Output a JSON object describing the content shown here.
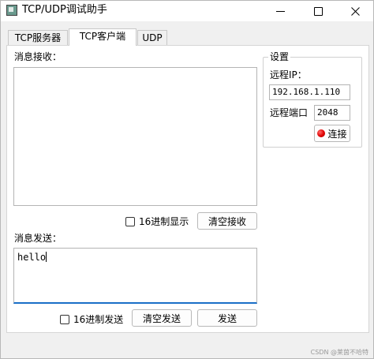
{
  "window": {
    "title": "TCP/UDP调试助手"
  },
  "tabs": [
    {
      "label": "TCP服务器",
      "active": false
    },
    {
      "label": "TCP客户端",
      "active": true
    },
    {
      "label": "UDP",
      "active": false
    }
  ],
  "receive": {
    "label": "消息接收：",
    "content": "",
    "hex_display_label": "16进制显示",
    "hex_display_checked": false,
    "clear_button": "清空接收"
  },
  "send": {
    "label": "消息发送：",
    "content": "hello",
    "hex_send_label": "16进制发送",
    "hex_send_checked": false,
    "clear_button": "清空发送",
    "send_button": "发送"
  },
  "settings": {
    "title": "设置",
    "remote_ip_label": "远程IP：",
    "remote_ip_value": "192.168.1.110",
    "remote_port_label": "远程端口",
    "remote_port_value": "2048",
    "connect_button": "连接",
    "status_color": "#e00000"
  },
  "watermark": "CSDN @莱茵不哈特"
}
